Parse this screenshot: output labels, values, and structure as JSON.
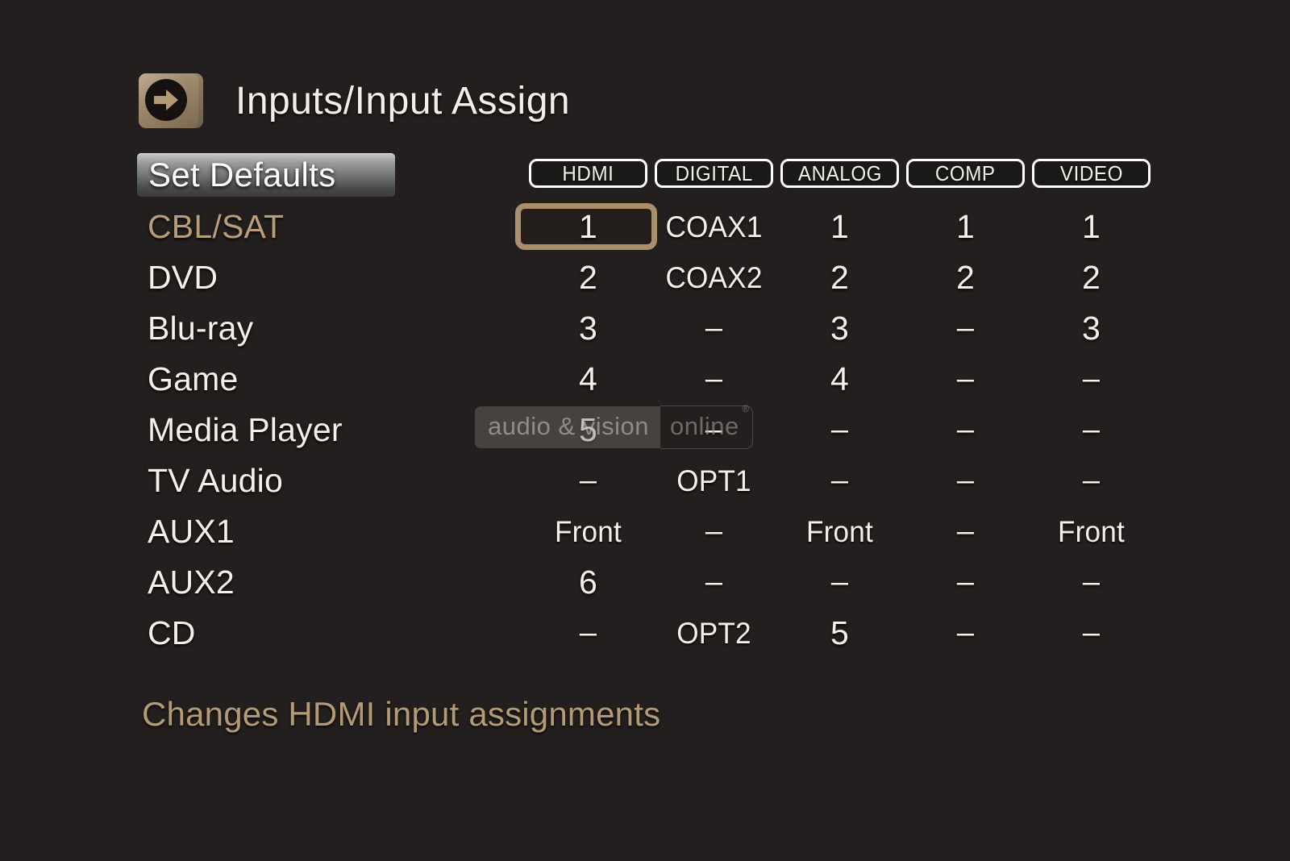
{
  "header": {
    "icon": "arrow-right-cards-icon",
    "title": "Inputs/Input Assign"
  },
  "buttons": {
    "set_defaults": "Set Defaults"
  },
  "table": {
    "columns": [
      "HDMI",
      "DIGITAL",
      "ANALOG",
      "COMP",
      "VIDEO"
    ],
    "rows": [
      {
        "label": "CBL/SAT",
        "active": true,
        "cells": [
          "1",
          "COAX1",
          "1",
          "1",
          "1"
        ],
        "selected_col": 0
      },
      {
        "label": "DVD",
        "active": false,
        "cells": [
          "2",
          "COAX2",
          "2",
          "2",
          "2"
        ],
        "selected_col": -1
      },
      {
        "label": "Blu-ray",
        "active": false,
        "cells": [
          "3",
          "–",
          "3",
          "–",
          "3"
        ],
        "selected_col": -1
      },
      {
        "label": "Game",
        "active": false,
        "cells": [
          "4",
          "–",
          "4",
          "–",
          "–"
        ],
        "selected_col": -1
      },
      {
        "label": "Media Player",
        "active": false,
        "cells": [
          "5",
          "–",
          "–",
          "–",
          "–"
        ],
        "selected_col": -1
      },
      {
        "label": "TV Audio",
        "active": false,
        "cells": [
          "–",
          "OPT1",
          "–",
          "–",
          "–"
        ],
        "selected_col": -1
      },
      {
        "label": "AUX1",
        "active": false,
        "cells": [
          "Front",
          "–",
          "Front",
          "–",
          "Front"
        ],
        "selected_col": -1
      },
      {
        "label": "AUX2",
        "active": false,
        "cells": [
          "6",
          "–",
          "–",
          "–",
          "–"
        ],
        "selected_col": -1
      },
      {
        "label": "CD",
        "active": false,
        "cells": [
          "–",
          "OPT2",
          "5",
          "–",
          "–"
        ],
        "selected_col": -1
      }
    ]
  },
  "footer": {
    "help_text": "Changes HDMI input assignments"
  },
  "watermark": {
    "part1": "audio & vision",
    "part2": "online",
    "registered": "®"
  },
  "colors": {
    "background": "#231f1e",
    "text": "#f4f1ea",
    "accent_tan": "#b79d79",
    "cursor_border": "#a98f6c",
    "help_text": "#b49a75",
    "header_border": "#ffffff"
  }
}
